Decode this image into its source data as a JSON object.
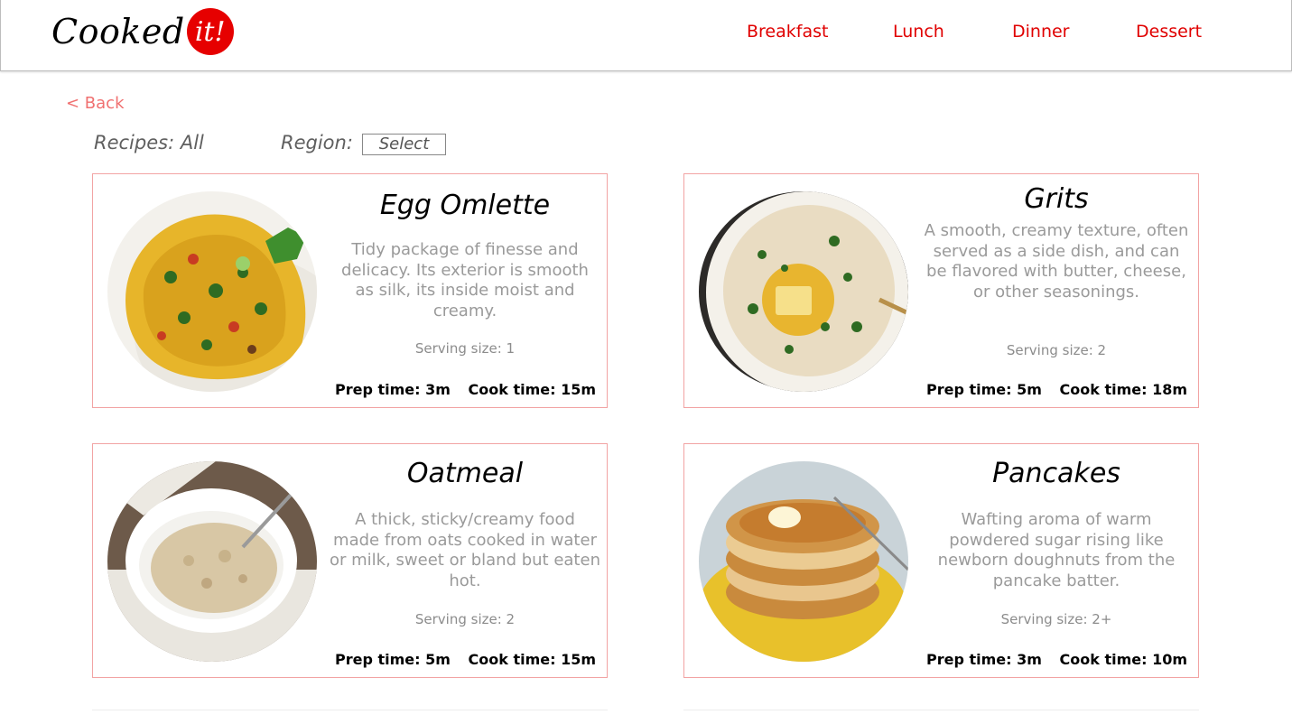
{
  "brand": {
    "word": "Cooked",
    "badge": "it!"
  },
  "nav": {
    "items": [
      {
        "label": "Breakfast"
      },
      {
        "label": "Lunch"
      },
      {
        "label": "Dinner"
      },
      {
        "label": "Dessert"
      }
    ]
  },
  "back": {
    "label": "< Back"
  },
  "filters": {
    "recipes_label": "Recipes: All",
    "region_label": "Region:",
    "region_value": "Select"
  },
  "recipes": [
    {
      "title": "Egg Omlette",
      "description": "Tidy package of finesse and delicacy. Its exterior is smooth as silk, its inside moist and creamy.",
      "serving": "Serving size: 1",
      "prep": "Prep time: 3m",
      "cook": "Cook time: 15m",
      "photo_icon": "omelette-photo"
    },
    {
      "title": "Grits",
      "description": "A smooth, creamy texture, often served as a side dish, and can be flavored with butter, cheese, or other seasonings.",
      "serving": "Serving size: 2",
      "prep": "Prep time: 5m",
      "cook": "Cook time: 18m",
      "photo_icon": "grits-photo"
    },
    {
      "title": "Oatmeal",
      "description": "A thick, sticky/creamy food made from oats cooked in water or milk, sweet or bland but eaten hot.",
      "serving": "Serving size: 2",
      "prep": "Prep time: 5m",
      "cook": "Cook time: 15m",
      "photo_icon": "oatmeal-photo"
    },
    {
      "title": "Pancakes",
      "description": "Wafting aroma of warm powdered sugar rising like newborn doughnuts from the pancake batter.",
      "serving": "Serving size: 2+",
      "prep": "Prep time: 3m",
      "cook": "Cook time: 10m",
      "photo_icon": "pancakes-photo"
    }
  ],
  "colors": {
    "brand_red": "#e60000",
    "nav_red": "#e00000",
    "back_link": "#f07070",
    "card_border": "#f2a3a3",
    "description_gray": "#9a9a9a"
  }
}
